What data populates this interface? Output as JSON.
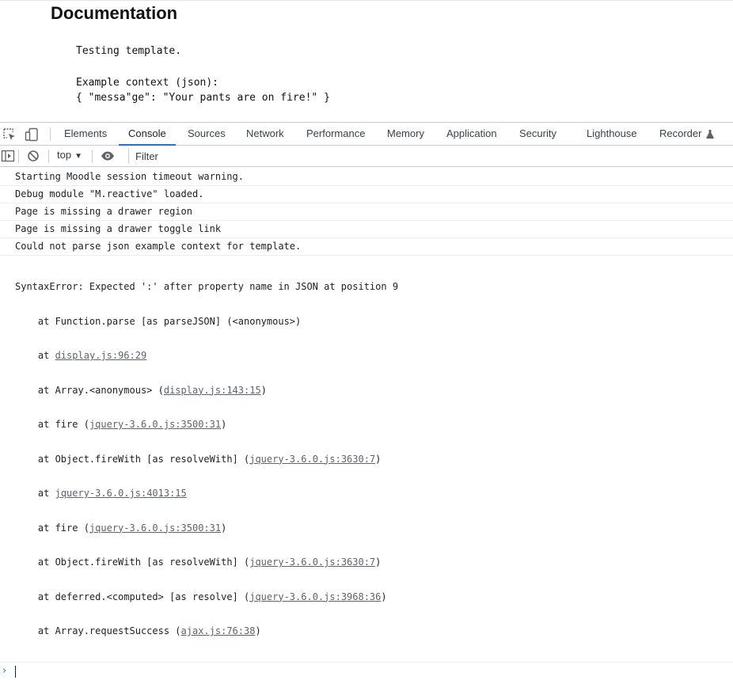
{
  "page": {
    "title": "Documentation",
    "lines": [
      "Testing template.",
      "",
      "Example context (json):",
      "{ \"messa\"ge\": \"Your pants are on fire!\" }"
    ]
  },
  "devtools": {
    "tabs": [
      "Elements",
      "Console",
      "Sources",
      "Network",
      "Performance",
      "Memory",
      "Application",
      "Security",
      "Lighthouse",
      "Recorder"
    ],
    "active_tab": "Console",
    "toolbar": {
      "icons": [
        "inspect-element-icon",
        "device-toggle-icon"
      ],
      "context_label": "top",
      "filter_placeholder": "Filter"
    },
    "console": {
      "messages": [
        "Starting Moodle session timeout warning.",
        "Debug module \"M.reactive\" loaded.",
        "Page is missing a drawer region",
        "Page is missing a drawer toggle link",
        "Could not parse json example context for template."
      ],
      "error": {
        "message": "SyntaxError: Expected ':' after property name in JSON at position 9",
        "frames": [
          {
            "text": "at Function.parse [as parseJSON] (<anonymous>)",
            "pre": "",
            "link": "",
            "post": ""
          },
          {
            "pre": "at ",
            "link": "display.js:96:29",
            "post": ""
          },
          {
            "pre": "at Array.<anonymous> (",
            "link": "display.js:143:15",
            "post": ")"
          },
          {
            "pre": "at fire (",
            "link": "jquery-3.6.0.js:3500:31",
            "post": ")"
          },
          {
            "pre": "at Object.fireWith [as resolveWith] (",
            "link": "jquery-3.6.0.js:3630:7",
            "post": ")"
          },
          {
            "pre": "at ",
            "link": "jquery-3.6.0.js:4013:15",
            "post": ""
          },
          {
            "pre": "at fire (",
            "link": "jquery-3.6.0.js:3500:31",
            "post": ")"
          },
          {
            "pre": "at Object.fireWith [as resolveWith] (",
            "link": "jquery-3.6.0.js:3630:7",
            "post": ")"
          },
          {
            "pre": "at deferred.<computed> [as resolve] (",
            "link": "jquery-3.6.0.js:3968:36",
            "post": ")"
          },
          {
            "pre": "at Array.requestSuccess (",
            "link": "ajax.js:76:38",
            "post": ")"
          }
        ]
      },
      "prompt_symbol": "›"
    }
  }
}
